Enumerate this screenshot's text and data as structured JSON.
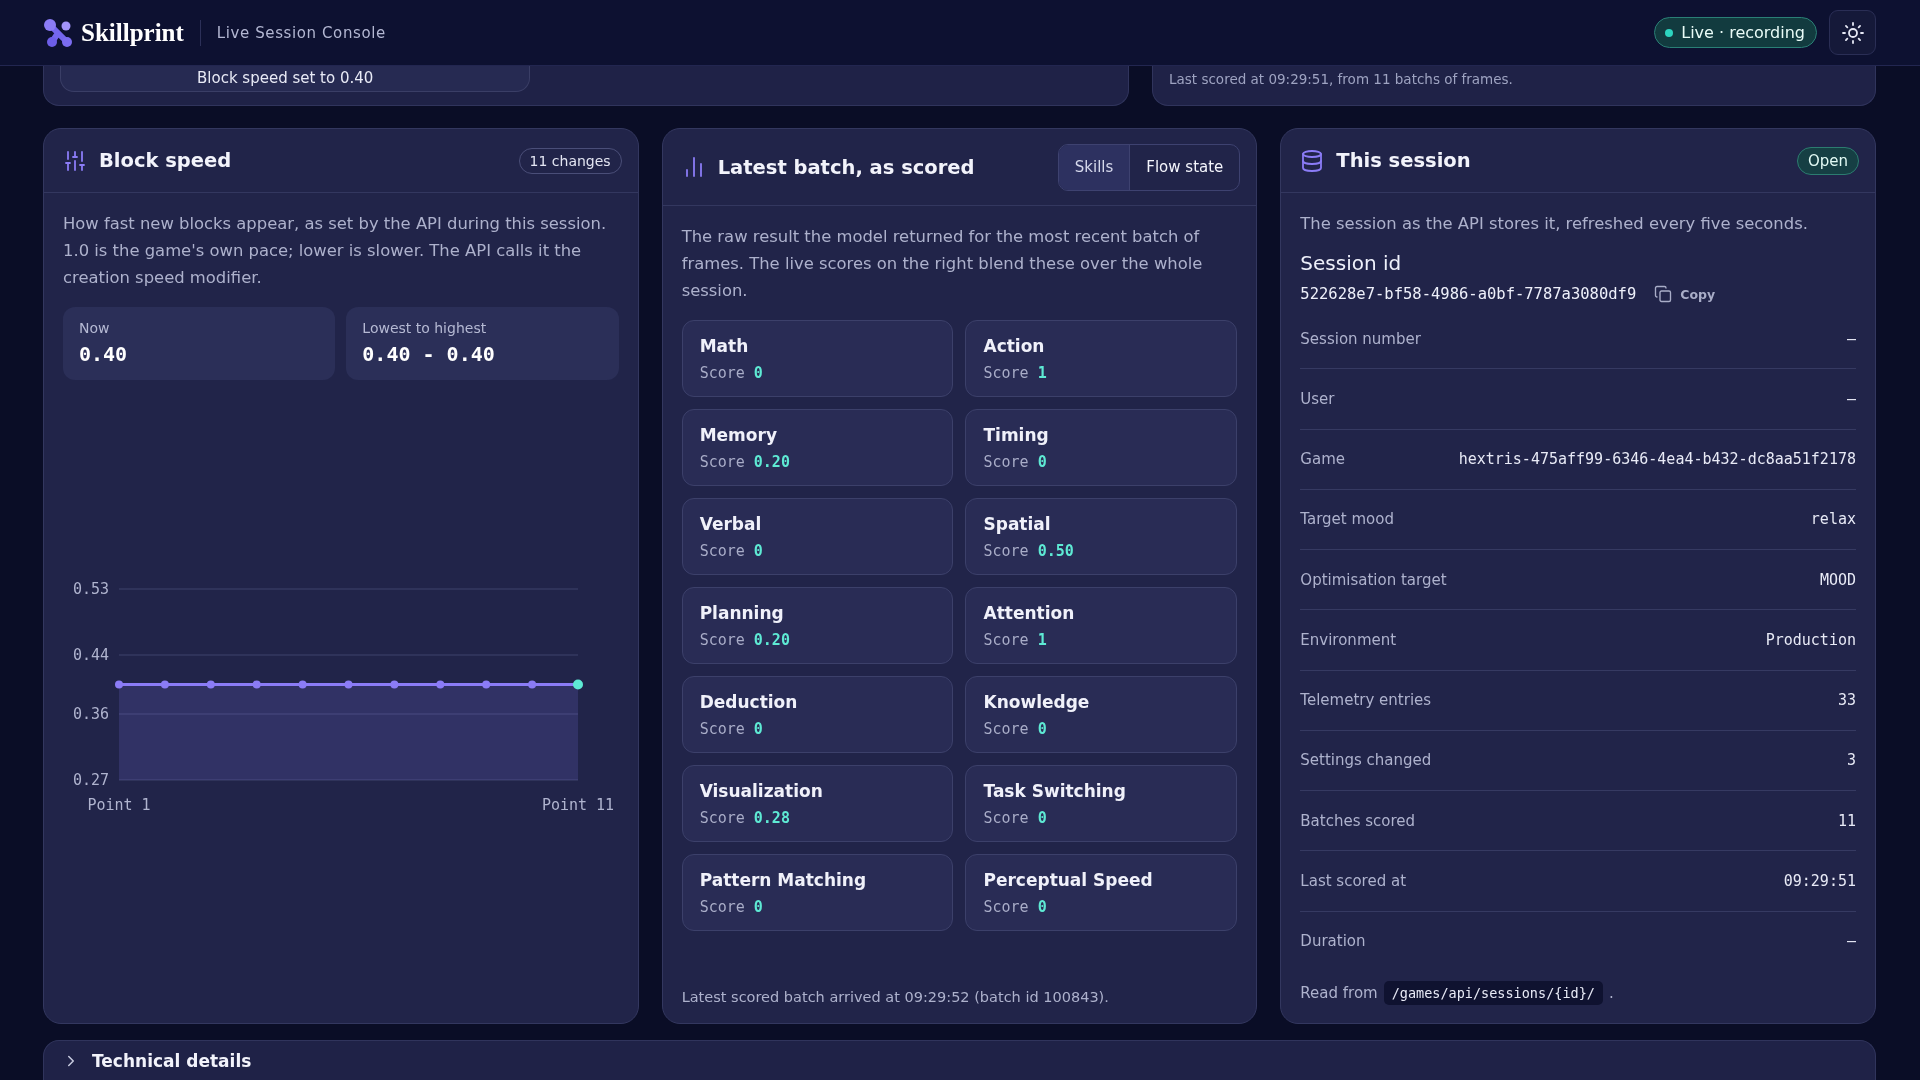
{
  "header": {
    "brand": "Skillprint",
    "subtitle": "Live Session Console",
    "status": {
      "label": "Live · recording",
      "live": true
    }
  },
  "scrolled_cards": {
    "speed_change": "Block speed set to 0.40",
    "scoring_summary": "Last scored at 09:29:51, from 11 batchs of frames."
  },
  "block_speed": {
    "title": "Block speed",
    "badge": "11 changes",
    "description": "How fast new blocks appear, as set by the API during this session. 1.0 is the game's own pace; lower is slower. The API calls it the creation speed modifier.",
    "stats": [
      {
        "label": "Now",
        "value": "0.40"
      },
      {
        "label": "Lowest to highest",
        "value": "0.40 - 0.40"
      }
    ],
    "chart_data": {
      "type": "area",
      "categories": [
        "Point 1",
        null,
        null,
        null,
        null,
        null,
        null,
        null,
        null,
        null,
        "Point 11"
      ],
      "values": [
        0.4,
        0.4,
        0.4,
        0.4,
        0.4,
        0.4,
        0.4,
        0.4,
        0.4,
        0.4,
        0.4
      ],
      "ylim": [
        0.27,
        0.53
      ],
      "yticks": [
        0.27,
        0.36,
        0.44,
        0.53
      ]
    }
  },
  "latest_batch": {
    "title": "Latest batch, as scored",
    "tabs": [
      {
        "label": "Skills",
        "selected": true
      },
      {
        "label": "Flow state",
        "selected": false
      }
    ],
    "description": "The raw result the model returned for the most recent batch of frames. The live scores on the right blend these over the whole session.",
    "skills": [
      {
        "name": "Math",
        "label": "Score",
        "value": "0"
      },
      {
        "name": "Action",
        "label": "Score",
        "value": "1"
      },
      {
        "name": "Memory",
        "label": "Score",
        "value": "0.20"
      },
      {
        "name": "Timing",
        "label": "Score",
        "value": "0"
      },
      {
        "name": "Verbal",
        "label": "Score",
        "value": "0"
      },
      {
        "name": "Spatial",
        "label": "Score",
        "value": "0.50"
      },
      {
        "name": "Planning",
        "label": "Score",
        "value": "0.20"
      },
      {
        "name": "Attention",
        "label": "Score",
        "value": "1"
      },
      {
        "name": "Deduction",
        "label": "Score",
        "value": "0"
      },
      {
        "name": "Knowledge",
        "label": "Score",
        "value": "0"
      },
      {
        "name": "Visualization",
        "label": "Score",
        "value": "0.28"
      },
      {
        "name": "Task Switching",
        "label": "Score",
        "value": "0"
      },
      {
        "name": "Pattern Matching",
        "label": "Score",
        "value": "0"
      },
      {
        "name": "Perceptual Speed",
        "label": "Score",
        "value": "0"
      }
    ],
    "footnote": "Latest scored batch arrived at 09:29:52 (batch id 100843)."
  },
  "session": {
    "title": "This session",
    "status": "Open",
    "description": "The session as the API stores it, refreshed every five seconds.",
    "id_heading": "Session id",
    "id": "522628e7-bf58-4986-a0bf-7787a3080df9",
    "copy_label": "Copy",
    "fields": [
      {
        "label": "Session number",
        "value": "–"
      },
      {
        "label": "User",
        "value": "–"
      },
      {
        "label": "Game",
        "value": "hextris-475aff99-6346-4ea4-b432-dc8aa51f2178"
      },
      {
        "label": "Target mood",
        "value": "relax"
      },
      {
        "label": "Optimisation target",
        "value": "MOOD"
      },
      {
        "label": "Environment",
        "value": "Production"
      },
      {
        "label": "Telemetry entries",
        "value": "33"
      },
      {
        "label": "Settings changed",
        "value": "3"
      },
      {
        "label": "Batches scored",
        "value": "11"
      },
      {
        "label": "Last scored at",
        "value": "09:29:51"
      },
      {
        "label": "Duration",
        "value": "–"
      }
    ],
    "source": {
      "prefix": "Read from",
      "path": "/games/api/sessions/{id}/",
      "suffix": "."
    }
  },
  "technical_details": {
    "title": "Technical details"
  }
}
